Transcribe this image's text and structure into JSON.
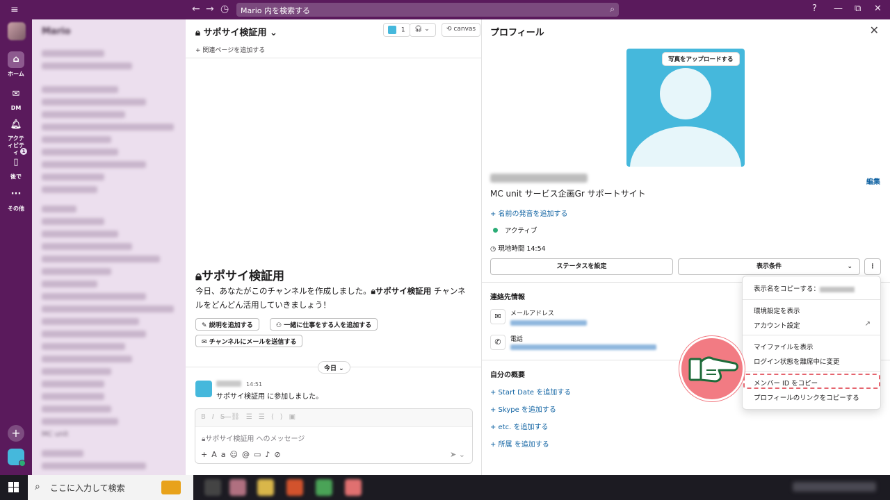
{
  "topbar": {
    "search_placeholder": "Mario 内を検索する",
    "help_icon": "?",
    "minimize": "—",
    "restore": "⧉",
    "close": "✕"
  },
  "rail": {
    "items": [
      {
        "label": "ホーム",
        "icon": "home-icon"
      },
      {
        "label": "DM",
        "icon": "dm-icon"
      },
      {
        "label": "アクティビティ",
        "icon": "bell-icon"
      },
      {
        "label": "後で",
        "icon": "bookmark-icon"
      },
      {
        "label": "その他",
        "icon": "more-icon"
      }
    ],
    "later_badge": "1"
  },
  "sidebar": {
    "workspace": "Mario",
    "footer_channel": "MC unit"
  },
  "channel": {
    "name": "サポサイ検証用",
    "members": "1",
    "canvas": "canvas",
    "related_page": "関連ページを追加する",
    "intro_title": "サポサイ検証用",
    "intro_text_1": "今日、あなたがこのチャンネルを作成しました。",
    "intro_channel": "サポサイ検証用",
    "intro_text_2": " チャンネルをどんどん活用していきましょう！",
    "btn_add_desc": "説明を追加する",
    "btn_add_people": "一緒に仕事をする人を追加する",
    "btn_send_email": "チャンネルにメールを送信する",
    "date_divider": "今日",
    "message": {
      "time": "14:51",
      "text": "サポサイ検証用 に参加しました。"
    },
    "composer_placeholder": "サポサイ検証用 へのメッセージ"
  },
  "profile": {
    "title": "プロフィール",
    "upload_photo": "写真をアップロードする",
    "edit": "編集",
    "org": "MC unit サービス企画Gr サポートサイト",
    "add_pronunciation": "+ 名前の発音を追加する",
    "status_active": "アクティブ",
    "local_time": "現地時間 14:54",
    "btn_set_status": "ステータスを設定",
    "btn_display_options": "表示条件",
    "contact_title": "連絡先情報",
    "email_label": "メールアドレス",
    "phone_label": "電話",
    "about_title": "自分の概要",
    "add_start_date": "+ Start Date を追加する",
    "add_skype": "+ Skype を追加する",
    "add_etc": "+ etc. を追加する",
    "add_affiliation": "+ 所属 を追加する"
  },
  "menu": {
    "copy_display_name": "表示名をコピーする：",
    "show_preferences": "環境設定を表示",
    "account_settings": "アカウント設定",
    "view_files": "マイファイルを表示",
    "set_away": "ログイン状態を離席中に変更",
    "copy_member_id": "メンバー ID をコピー",
    "copy_profile_link": "プロフィールのリンクをコピーする"
  },
  "taskbar": {
    "search_placeholder": "ここに入力して検索"
  },
  "colors": {
    "aubergine": "#5a1a5c",
    "link": "#1264a3",
    "active_green": "#2bac76",
    "avatar_blue": "#45b8dc",
    "highlight_red": "#e5656f"
  }
}
